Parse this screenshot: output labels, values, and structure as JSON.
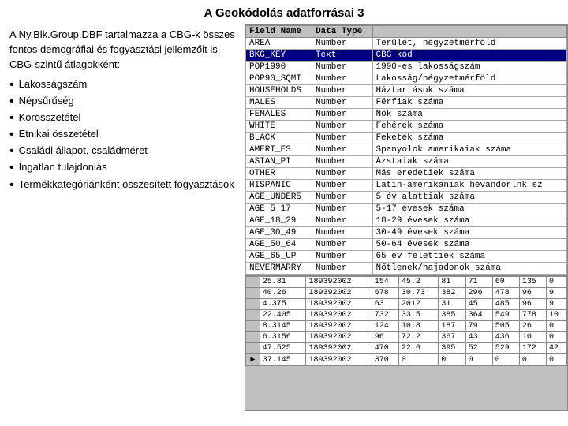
{
  "title": "A Geokódolás adatforrásai 3",
  "left": {
    "intro": "A Ny.Blk.Group.DBF tartalmazza a CBG-k összes fontos demográfiai és fogyasztási jellemzőit is, CBG-szintű átlagokként:",
    "bullets": [
      "Lakosságszám",
      "Népsűrűség",
      "Korösszetétel",
      "Etnikai összetétel",
      "Családi állapot, családméret",
      "Ingatlan tulajdonlás",
      "Termékkategóriánként összesített fogyasztások"
    ]
  },
  "top_table": {
    "headers": [
      "Field Name",
      "Data Type"
    ],
    "rows": [
      [
        "AREA",
        "Number",
        "Terület, négyzetmérföld"
      ],
      [
        "BKG_KEY",
        "Text",
        "CBG kód"
      ],
      [
        "POP1990",
        "Number",
        "1990-es lakosságszám"
      ],
      [
        "POP90_SQMI",
        "Number",
        "Lakosság/négyzetmérföld"
      ],
      [
        "HOUSEHOLDS",
        "Number",
        "Háztartások száma"
      ],
      [
        "MALES",
        "Number",
        "Férfiak száma"
      ],
      [
        "FEMALES",
        "Number",
        "Nők száma"
      ],
      [
        "WHITE",
        "Number",
        "Fehérek száma"
      ],
      [
        "BLACK",
        "Number",
        "Feketék száma"
      ],
      [
        "AMERI_ES",
        "Number",
        "Spanyolok amerikaiak száma"
      ],
      [
        "ASIAN_PI",
        "Number",
        "Ázstaiak száma"
      ],
      [
        "OTHER",
        "Number",
        "Más eredetiek száma"
      ],
      [
        "HISPANIC",
        "Number",
        "Latin-amerikaniak hévándorlnk sz"
      ],
      [
        "AGE_UNDER5",
        "Number",
        "5 év alattiak száma"
      ],
      [
        "AGE_5_17",
        "Number",
        "5-17 évesek száma"
      ],
      [
        "AGE_18_29",
        "Number",
        "18-29 évesek száma"
      ],
      [
        "AGE_30_49",
        "Number",
        "30-49 évesek száma"
      ],
      [
        "AGE_50_64",
        "Number",
        "50-64 évesek száma"
      ],
      [
        "AGE_65_UP",
        "Number",
        "65 év felettiek száma"
      ],
      [
        "NEVERMARRY",
        "Number",
        "Nőtlenek/hajadonok száma"
      ]
    ]
  },
  "bottom_table": {
    "rows": [
      [
        "",
        "25.81",
        "189392002",
        "154",
        "45.2",
        "81",
        "71",
        "60",
        "135",
        "0"
      ],
      [
        "",
        "40.26",
        "189392002",
        "678",
        "30.73",
        "382",
        "296",
        "478",
        "96",
        "9"
      ],
      [
        "",
        "4.375",
        "189392002",
        "63",
        "2012",
        "31",
        "45",
        "485",
        "96",
        "9"
      ],
      [
        "",
        "22.405",
        "189392002",
        "732",
        "33.5",
        "385",
        "364",
        "549",
        "778",
        "10"
      ],
      [
        "",
        "8.3145",
        "189392002",
        "124",
        "10.8",
        "187",
        "79",
        "505",
        "26",
        "0"
      ],
      [
        "",
        "6.3156",
        "189392002",
        "96",
        "72.2",
        "367",
        "43",
        "436",
        "10",
        "0"
      ],
      [
        "",
        "47.525",
        "189392002",
        "470",
        "22.6",
        "395",
        "52",
        "529",
        "172",
        "42"
      ],
      [
        "▶",
        "37.145",
        "189392002",
        "370",
        "0",
        "0",
        "0",
        "0",
        "0",
        "0"
      ]
    ]
  }
}
